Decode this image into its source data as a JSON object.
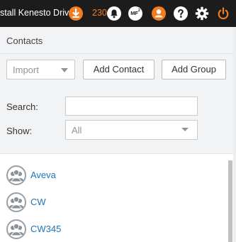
{
  "topbar": {
    "install_text": "stall Kenesto Drive",
    "notification_count": "230",
    "user_initials": "MF",
    "user_initials_sup": "2",
    "accent": "#f07d20"
  },
  "panel": {
    "title": "Contacts",
    "import_select": {
      "value": "Import"
    },
    "buttons": {
      "add_contact": "Add Contact",
      "add_group": "Add Group"
    },
    "filters": {
      "search_label": "Search:",
      "search_value": "",
      "show_label": "Show:",
      "show_value": "All"
    },
    "contacts": [
      {
        "name": "Aveva"
      },
      {
        "name": "CW"
      },
      {
        "name": "CW345"
      }
    ]
  }
}
